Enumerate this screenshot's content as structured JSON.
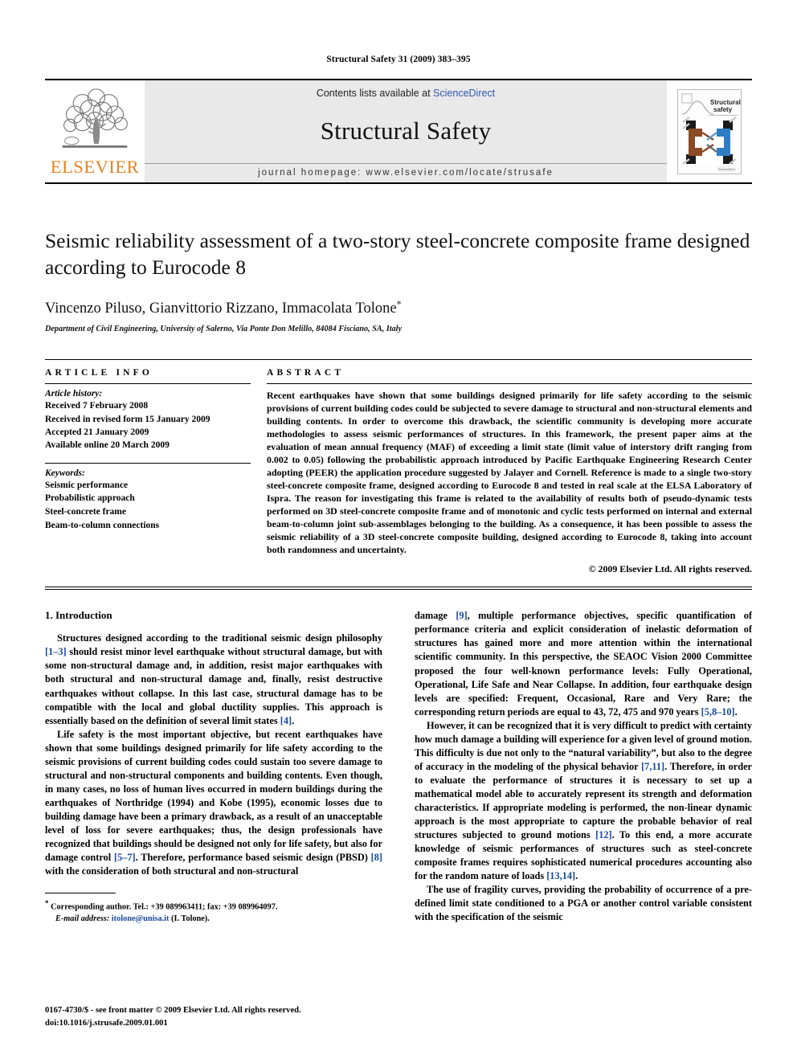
{
  "running_head": "Structural Safety 31 (2009) 383–395",
  "masthead": {
    "contents_prefix": "Contents lists available at ",
    "sciencedirect": "ScienceDirect",
    "journal_name": "Structural Safety",
    "homepage": "journal homepage: www.elsevier.com/locate/strusafe",
    "publisher_wordmark": "ELSEVIER",
    "publisher_color": "#E8821E",
    "cover_title_line1": "Structural",
    "cover_title_line2": "safety",
    "link_color": "#2b59b0"
  },
  "article": {
    "title": "Seismic reliability assessment of a two-story steel-concrete composite frame designed according to Eurocode 8",
    "authors": "Vincenzo Piluso, Gianvittorio Rizzano, Immacolata Tolone",
    "corresponding_marker": "*",
    "affiliation": "Department of Civil Engineering, University of Salerno, Via Ponte Don Melillo, 84084 Fisciano, SA, Italy"
  },
  "article_info": {
    "heading": "ARTICLE INFO",
    "history_label": "Article history:",
    "history": [
      "Received 7 February 2008",
      "Received in revised form 15 January 2009",
      "Accepted 21 January 2009",
      "Available online 20 March 2009"
    ],
    "keywords_label": "Keywords:",
    "keywords": [
      "Seismic performance",
      "Probabilistic approach",
      "Steel-concrete frame",
      "Beam-to-column connections"
    ]
  },
  "abstract": {
    "heading": "ABSTRACT",
    "text": "Recent earthquakes have shown that some buildings designed primarily for life safety according to the seismic provisions of current building codes could be subjected to severe damage to structural and non-structural elements and building contents. In order to overcome this drawback, the scientific community is developing more accurate methodologies to assess seismic performances of structures. In this framework, the present paper aims at the evaluation of mean annual frequency (MAF) of exceeding a limit state (limit value of interstory drift ranging from 0.002 to 0.05) following the probabilistic approach introduced by Pacific Earthquake Engineering Research Center adopting (PEER) the application procedure suggested by Jalayer and Cornell. Reference is made to a single two-story steel-concrete composite frame, designed according to Eurocode 8 and tested in real scale at the ELSA Laboratory of Ispra. The reason for investigating this frame is related to the availability of results both of pseudo-dynamic tests performed on 3D steel-concrete composite frame and of monotonic and cyclic tests performed on internal and external beam-to-column joint sub-assemblages belonging to the building. As a consequence, it has been possible to assess the seismic reliability of a 3D steel-concrete composite building, designed according to Eurocode 8, taking into account both randomness and uncertainty.",
    "copyright": "© 2009 Elsevier Ltd. All rights reserved."
  },
  "body": {
    "section_title": "1. Introduction",
    "left_paragraphs": [
      "Structures designed according to the traditional seismic design philosophy [1–3] should resist minor level earthquake without structural damage, but with some non-structural damage and, in addition, resist major earthquakes with both structural and non-structural damage and, finally, resist destructive earthquakes without collapse. In this last case, structural damage has to be compatible with the local and global ductility supplies. This approach is essentially based on the definition of several limit states [4].",
      "Life safety is the most important objective, but recent earthquakes have shown that some buildings designed primarily for life safety according to the seismic provisions of current building codes could sustain too severe damage to structural and non-structural components and building contents. Even though, in many cases, no loss of human lives occurred in modern buildings during the earthquakes of Northridge (1994) and Kobe (1995), economic losses due to building damage have been a primary drawback, as a result of an unacceptable level of loss for severe earthquakes; thus, the design professionals have recognized that buildings should be designed not only for life safety, but also for damage control [5–7]. Therefore, performance based seismic design (PBSD) [8] with the consideration of both structural and non-structural"
    ],
    "right_paragraphs": [
      "damage [9], multiple performance objectives, specific quantification of performance criteria and explicit consideration of inelastic deformation of structures has gained more and more attention within the international scientific community. In this perspective, the SEAOC Vision 2000 Committee proposed the four well-known performance levels: Fully Operational, Operational, Life Safe and Near Collapse. In addition, four earthquake design levels are specified: Frequent, Occasional, Rare and Very Rare; the corresponding return periods are equal to 43, 72, 475 and 970 years [5,8–10].",
      "However, it can be recognized that it is very difficult to predict with certainty how much damage a building will experience for a given level of ground motion. This difficulty is due not only to the “natural variability”, but also to the degree of accuracy in the modeling of the physical behavior [7,11]. Therefore, in order to evaluate the performance of structures it is necessary to set up a mathematical model able to accurately represent its strength and deformation characteristics. If appropriate modeling is performed, the non-linear dynamic approach is the most appropriate to capture the probable behavior of real structures subjected to ground motions [12]. To this end, a more accurate knowledge of seismic performances of structures such as steel-concrete composite frames requires sophisticated numerical procedures accounting also for the random nature of loads [13,14].",
      "The use of fragility curves, providing the probability of occurrence of a pre-defined limit state conditioned to a PGA or another control variable consistent with the specification of the seismic"
    ],
    "reference_color": "#17489e"
  },
  "footnote": {
    "bullet": "*",
    "corresponding": "Corresponding author. Tel.: +39 089963411; fax: +39 089964097.",
    "email_label": "E-mail address:",
    "email": "itolone@unisa.it",
    "email_suffix": "(I. Tolone)."
  },
  "footer": {
    "line1": "0167-4730/$ - see front matter © 2009 Elsevier Ltd. All rights reserved.",
    "line2": "doi:10.1016/j.strusafe.2009.01.001"
  }
}
